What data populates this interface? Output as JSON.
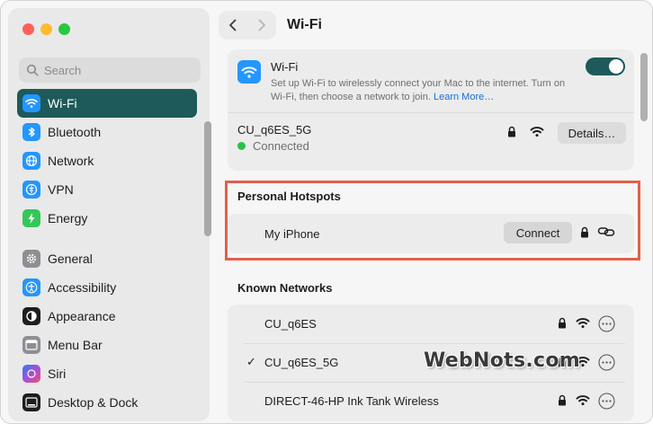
{
  "window": {
    "title": "Wi-Fi"
  },
  "sidebar": {
    "search_placeholder": "Search",
    "items": [
      {
        "label": "Wi-Fi",
        "icon": "wifi-icon",
        "color": "#2496ff",
        "active": true
      },
      {
        "label": "Bluetooth",
        "icon": "bluetooth-icon",
        "color": "#2496ff"
      },
      {
        "label": "Network",
        "icon": "globe-icon",
        "color": "#2496ff"
      },
      {
        "label": "VPN",
        "icon": "vpn-icon",
        "color": "#2496ff"
      },
      {
        "label": "Energy",
        "icon": "bolt-icon",
        "color": "#34c759"
      },
      {
        "label": "General",
        "icon": "gear-icon",
        "color": "#8e8e93"
      },
      {
        "label": "Accessibility",
        "icon": "accessibility-icon",
        "color": "#2496ff"
      },
      {
        "label": "Appearance",
        "icon": "appearance-icon",
        "color": "#1d1d1f"
      },
      {
        "label": "Menu Bar",
        "icon": "menubar-icon",
        "color": "#8e8e93"
      },
      {
        "label": "Siri",
        "icon": "siri-icon",
        "color": "#a64ed9"
      },
      {
        "label": "Desktop & Dock",
        "icon": "dock-icon",
        "color": "#1d1d1f"
      }
    ]
  },
  "wifi": {
    "title": "Wi-Fi",
    "description": "Set up Wi-Fi to wirelessly connect your Mac to the internet. Turn on Wi-Fi, then choose a network to join.",
    "learn_more": "Learn More…",
    "enabled": true,
    "current_network": "CU_q6ES_5G",
    "status": "Connected",
    "details_label": "Details…"
  },
  "hotspots": {
    "title": "Personal Hotspots",
    "name": "My iPhone",
    "connect_label": "Connect"
  },
  "known": {
    "title": "Known Networks",
    "networks": [
      {
        "name": "CU_q6ES",
        "checked": false
      },
      {
        "name": "CU_q6ES_5G",
        "checked": true
      },
      {
        "name": "DIRECT-46-HP Ink Tank Wireless",
        "checked": false
      }
    ]
  },
  "watermark": "WebNots.com",
  "colors": {
    "accent": "#1e5a5a",
    "highlight_border": "#e2604c",
    "link": "#1a6fd6",
    "connected": "#29c244"
  }
}
